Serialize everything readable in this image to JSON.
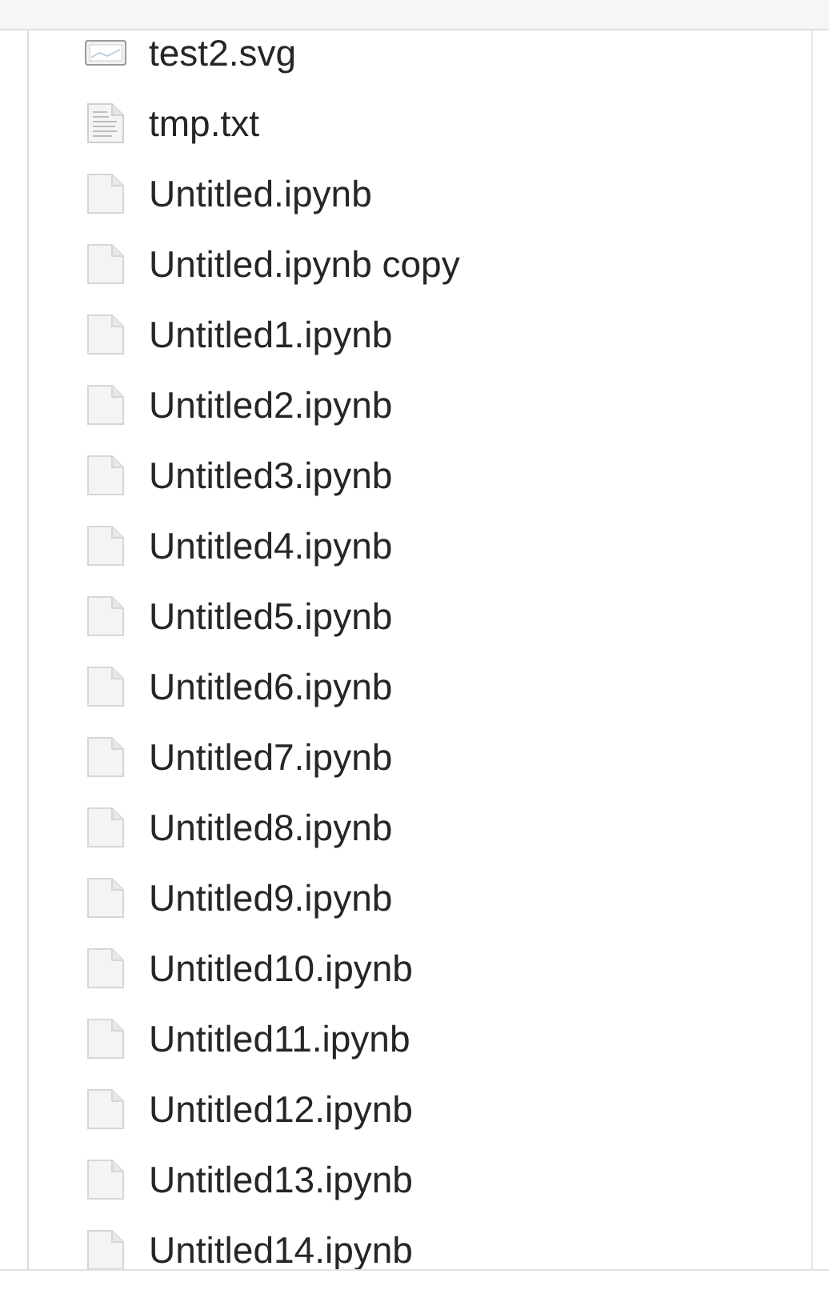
{
  "files": [
    {
      "name": "test2.svg",
      "kind": "image"
    },
    {
      "name": "tmp.txt",
      "kind": "text"
    },
    {
      "name": "Untitled.ipynb",
      "kind": "blank"
    },
    {
      "name": "Untitled.ipynb copy",
      "kind": "blank"
    },
    {
      "name": "Untitled1.ipynb",
      "kind": "blank"
    },
    {
      "name": "Untitled2.ipynb",
      "kind": "blank"
    },
    {
      "name": "Untitled3.ipynb",
      "kind": "blank"
    },
    {
      "name": "Untitled4.ipynb",
      "kind": "blank"
    },
    {
      "name": "Untitled5.ipynb",
      "kind": "blank"
    },
    {
      "name": "Untitled6.ipynb",
      "kind": "blank"
    },
    {
      "name": "Untitled7.ipynb",
      "kind": "blank"
    },
    {
      "name": "Untitled8.ipynb",
      "kind": "blank"
    },
    {
      "name": "Untitled9.ipynb",
      "kind": "blank"
    },
    {
      "name": "Untitled10.ipynb",
      "kind": "blank"
    },
    {
      "name": "Untitled11.ipynb",
      "kind": "blank"
    },
    {
      "name": "Untitled12.ipynb",
      "kind": "blank"
    },
    {
      "name": "Untitled13.ipynb",
      "kind": "blank"
    },
    {
      "name": "Untitled14.ipynb",
      "kind": "blank"
    }
  ]
}
